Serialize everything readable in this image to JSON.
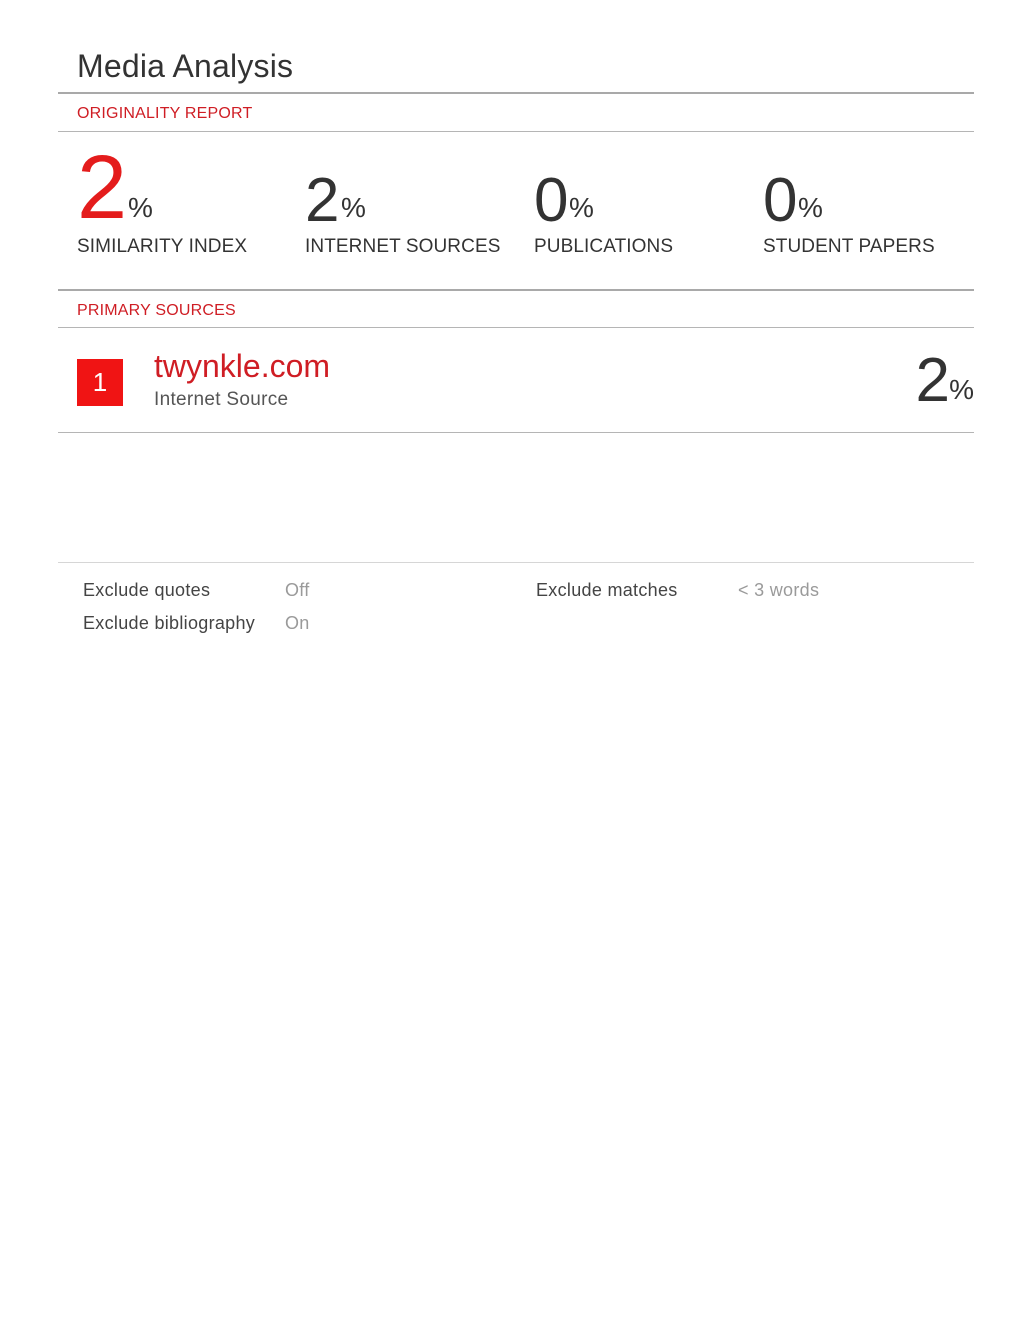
{
  "document": {
    "title": "Media Analysis"
  },
  "originality_report": {
    "label": "ORIGINALITY REPORT",
    "stats": [
      {
        "value": "2",
        "unit": "%",
        "label": "SIMILARITY INDEX"
      },
      {
        "value": "2",
        "unit": "%",
        "label": "INTERNET SOURCES"
      },
      {
        "value": "0",
        "unit": "%",
        "label": "PUBLICATIONS"
      },
      {
        "value": "0",
        "unit": "%",
        "label": "STUDENT PAPERS"
      }
    ]
  },
  "primary_sources": {
    "label": "PRIMARY SOURCES",
    "items": [
      {
        "rank": "1",
        "domain": "twynkle.com",
        "type": "Internet Source",
        "value": "2",
        "unit": "%"
      }
    ]
  },
  "settings": {
    "exclude_quotes_label": "Exclude quotes",
    "exclude_quotes_value": "Off",
    "exclude_bibliography_label": "Exclude bibliography",
    "exclude_bibliography_value": "On",
    "exclude_matches_label": "Exclude matches",
    "exclude_matches_value": "< 3 words"
  },
  "colors": {
    "accent_red": "#cf1d24",
    "badge_red": "#f01414",
    "text_dark": "#333333",
    "text_muted": "#9a9a9a"
  }
}
